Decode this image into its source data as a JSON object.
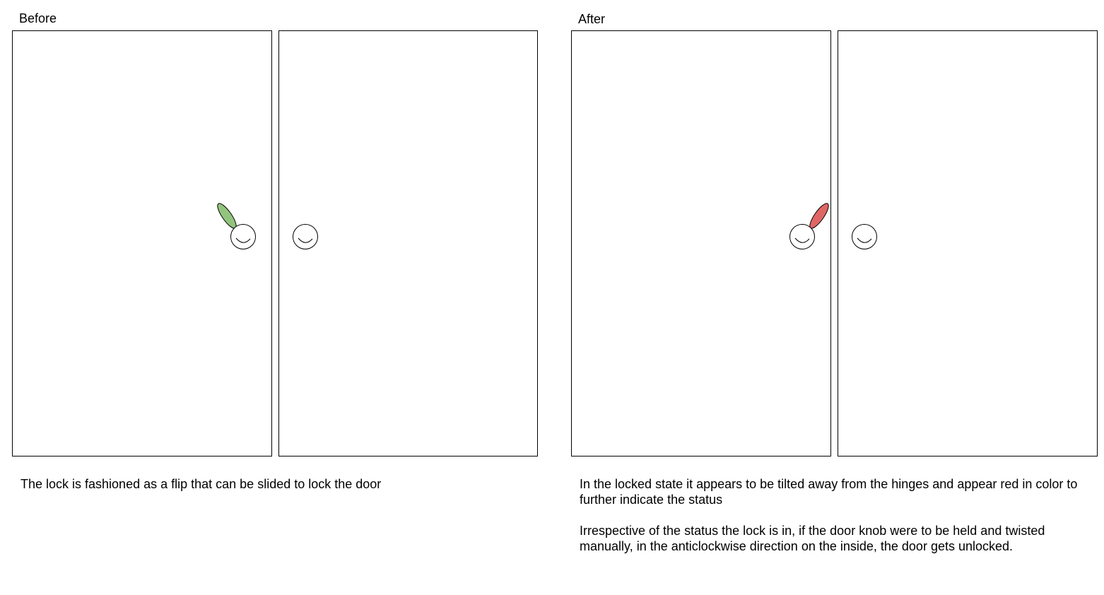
{
  "panels": {
    "before": {
      "title": "Before",
      "caption": "The lock is fashioned as a flip that can be slided to lock the door",
      "lock_state": "unlocked",
      "lock_color": "#93c47d"
    },
    "after": {
      "title": "After",
      "caption_1": "In the locked state it appears to be tilted away from the hinges and appear red in color to further indicate the status",
      "caption_2": "Irrespective of the status the lock is in, if the door knob were to be held and twisted manually, in the anticlockwise direction on the inside, the door gets unlocked.",
      "lock_state": "locked",
      "lock_color": "#e06666"
    }
  },
  "colors": {
    "stroke": "#000000",
    "background": "#ffffff"
  }
}
